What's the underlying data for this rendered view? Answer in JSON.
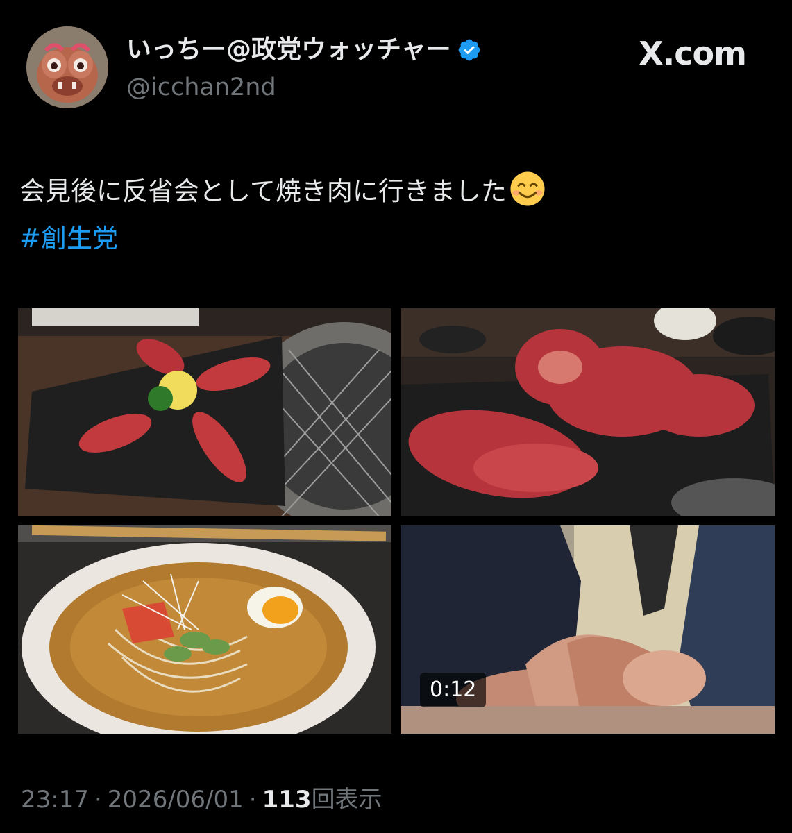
{
  "author": {
    "display_name": "いっちー@政党ウォッチャー",
    "handle": "@icchan2nd",
    "verified": true,
    "avatar_icon": "shisa-figurine-avatar"
  },
  "source_label": "X.com",
  "tweet": {
    "text": "会見後に反省会として焼き肉に行きました",
    "emoji": "smiling-face-emoji",
    "hashtag": "#創生党"
  },
  "media": [
    {
      "name": "wagyu-sushi-photo"
    },
    {
      "name": "raw-yakiniku-platter-photo"
    },
    {
      "name": "cold-noodle-photo"
    },
    {
      "name": "stacked-hands-video",
      "duration": "0:12"
    }
  ],
  "meta": {
    "time": "23:17",
    "separator": "·",
    "date": "2026/06/01",
    "views_count": "113",
    "views_label": "回表示"
  },
  "colors": {
    "background": "#000000",
    "text": "#e7e9ea",
    "secondary": "#71767b",
    "accent": "#1d9bf0"
  }
}
